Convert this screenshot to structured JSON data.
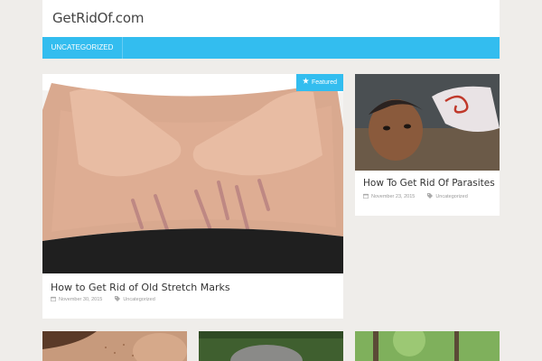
{
  "site": {
    "title": "GetRidOf.com"
  },
  "nav": {
    "items": [
      {
        "label": "UNCATEGORIZED"
      }
    ]
  },
  "posts": [
    {
      "title": "How to Get Rid of Old Stretch Marks",
      "date": "November 30, 2015",
      "category": "Uncategorized",
      "badge": "Featured"
    },
    {
      "title": "How To Get Rid Of Parasites",
      "date": "November 23, 2015",
      "category": "Uncategorized"
    }
  ],
  "icons": {
    "date": "calendar-icon",
    "category": "tag-icon",
    "badge": "star-icon"
  },
  "colors": {
    "accent": "#33bdef",
    "background": "#efedea"
  }
}
